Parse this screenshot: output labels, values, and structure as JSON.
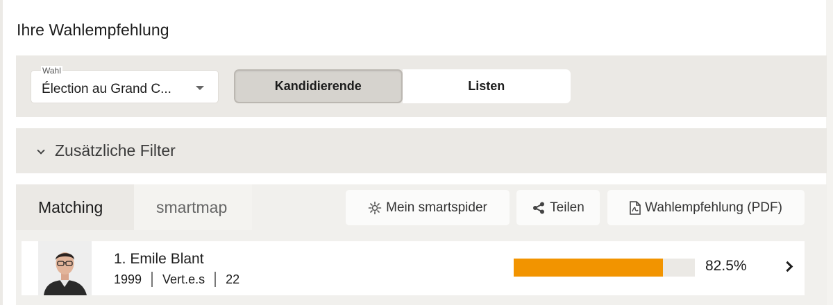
{
  "page": {
    "title": "Ihre Wahlempfehlung"
  },
  "election_select": {
    "legend": "Wahl",
    "value": "Élection au Grand C..."
  },
  "view_toggle": {
    "candidates_label": "Kandidierende",
    "lists_label": "Listen",
    "active": "candidates"
  },
  "filters": {
    "label": "Zusätzliche Filter",
    "icon": "chevron-down-icon"
  },
  "results_tabs": [
    {
      "label": "Matching",
      "active": true
    },
    {
      "label": "smartmap",
      "active": false
    }
  ],
  "actions": {
    "smartspider": {
      "label": "Mein smartspider",
      "icon": "spider-icon"
    },
    "share": {
      "label": "Teilen",
      "icon": "share-icon"
    },
    "pdf": {
      "label": "Wahlempfehlung (PDF)",
      "icon": "pdf-icon"
    }
  },
  "candidates": [
    {
      "name": "1. Emile Blant",
      "year": "1999",
      "party": "Vert.e.s",
      "list_no": "22",
      "match_percent": 82.5,
      "match_label": "82.5%"
    }
  ],
  "colors": {
    "accent": "#f29400",
    "panel": "#ebe9e5",
    "active_toggle": "#d6d3ce"
  }
}
